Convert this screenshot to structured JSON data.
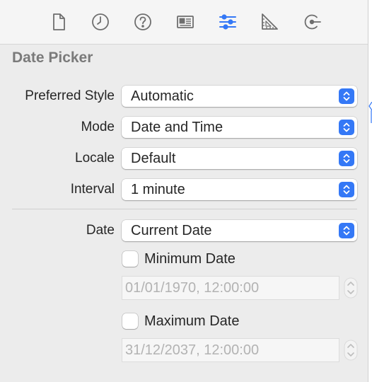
{
  "toolbar": {
    "icons": [
      {
        "name": "file-inspector-icon"
      },
      {
        "name": "history-inspector-icon"
      },
      {
        "name": "quick-help-icon"
      },
      {
        "name": "identity-inspector-icon"
      },
      {
        "name": "attributes-inspector-icon",
        "selected": true
      },
      {
        "name": "size-inspector-icon"
      },
      {
        "name": "connections-inspector-icon"
      }
    ],
    "accent_color": "#3478f6",
    "icon_color": "#6e6e6e"
  },
  "section": {
    "title": "Date Picker"
  },
  "fields": {
    "preferred_style": {
      "label": "Preferred Style",
      "value": "Automatic"
    },
    "mode": {
      "label": "Mode",
      "value": "Date and Time"
    },
    "locale": {
      "label": "Locale",
      "value": "Default"
    },
    "interval": {
      "label": "Interval",
      "value": "1 minute"
    },
    "date": {
      "label": "Date",
      "value": "Current Date"
    }
  },
  "minimum_date": {
    "label": "Minimum Date",
    "checked": false,
    "value": "01/01/1970, 12:00:00"
  },
  "maximum_date": {
    "label": "Maximum Date",
    "checked": false,
    "value": "31/12/2037, 12:00:00"
  }
}
